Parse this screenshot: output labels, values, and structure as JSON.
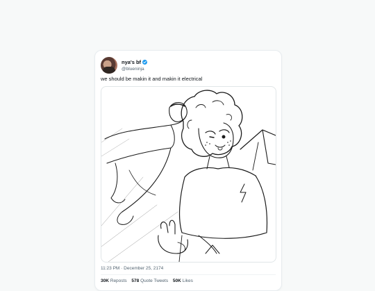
{
  "tweet": {
    "display_name": "nya's bf",
    "handle": "@blueninja",
    "text": "we should be makin it and makin it electrical",
    "time": "11:23 PM",
    "separator": "·",
    "date": "December 25, 2174",
    "stats": {
      "reposts_count": "30K",
      "reposts_label": "Reposts",
      "quotes_count": "578",
      "quotes_label": "Quote Tweets",
      "likes_count": "50K",
      "likes_label": "Likes"
    }
  },
  "colors": {
    "verified_badge": "#1d9bf0",
    "text_primary": "#0f1419",
    "text_secondary": "#536471"
  }
}
